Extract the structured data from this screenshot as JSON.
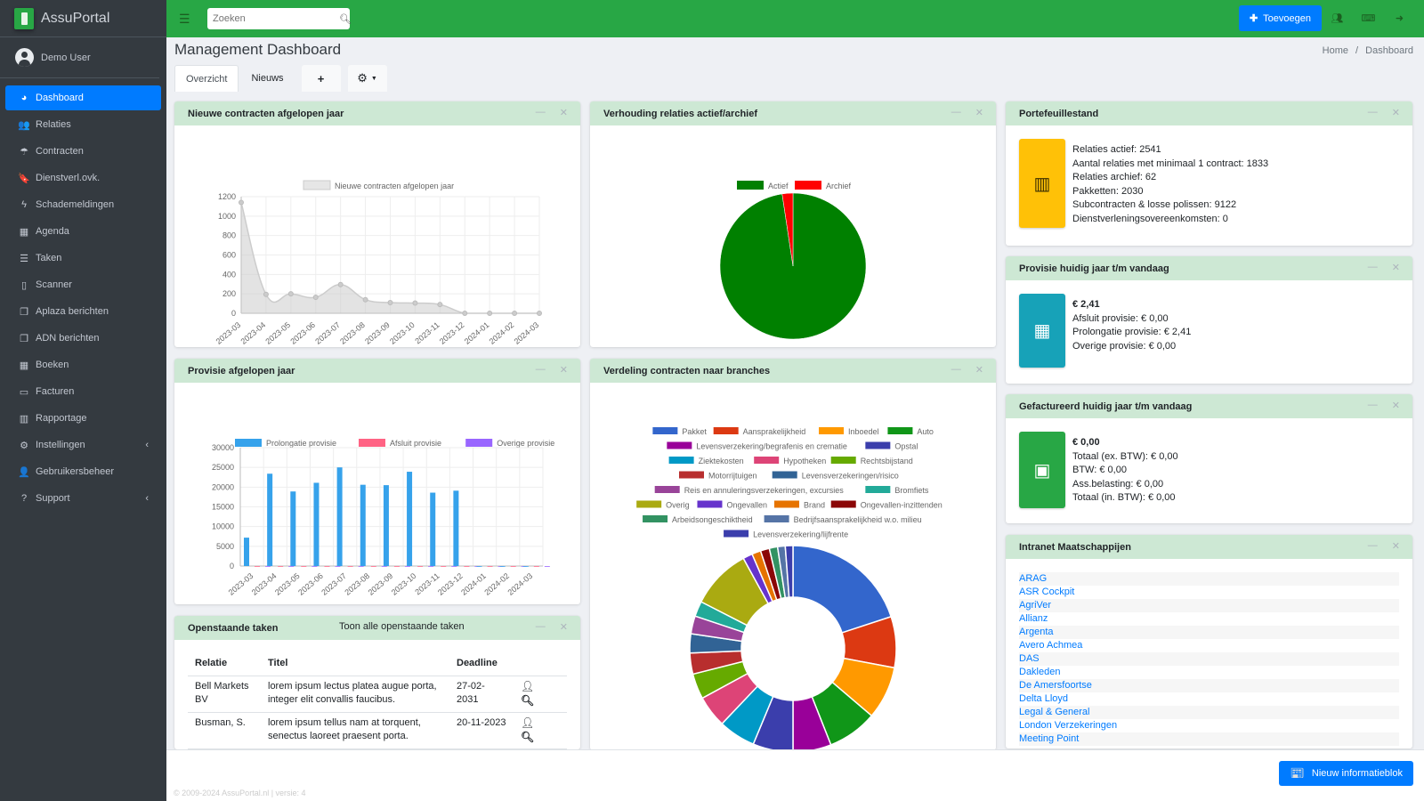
{
  "app": {
    "name": "AssuPortal",
    "user": "Demo User"
  },
  "sidebar": {
    "items": [
      {
        "label": "Dashboard",
        "icon": "dashboard-icon",
        "glyph": "◕",
        "active": true
      },
      {
        "label": "Relaties",
        "icon": "users-icon",
        "glyph": "👥"
      },
      {
        "label": "Contracten",
        "icon": "umbrella-icon",
        "glyph": "☂"
      },
      {
        "label": "Dienstverl.ovk.",
        "icon": "bookmark-icon",
        "glyph": "🔖"
      },
      {
        "label": "Schademeldingen",
        "icon": "bolt-icon",
        "glyph": "ϟ"
      },
      {
        "label": "Agenda",
        "icon": "calendar-icon",
        "glyph": "▦"
      },
      {
        "label": "Taken",
        "icon": "tasks-icon",
        "glyph": "☰"
      },
      {
        "label": "Scanner",
        "icon": "file-pdf-icon",
        "glyph": "▯"
      },
      {
        "label": "Aplaza berichten",
        "icon": "copy-icon",
        "glyph": "❐"
      },
      {
        "label": "ADN berichten",
        "icon": "copy-icon",
        "glyph": "❐"
      },
      {
        "label": "Boeken",
        "icon": "calculator-icon",
        "glyph": "▦"
      },
      {
        "label": "Facturen",
        "icon": "money-icon",
        "glyph": "▭"
      },
      {
        "label": "Rapportage",
        "icon": "chart-bar-icon",
        "glyph": "▥"
      },
      {
        "label": "Instellingen",
        "icon": "cog-icon",
        "glyph": "⚙",
        "submenu": true
      },
      {
        "label": "Gebruikersbeheer",
        "icon": "user-icon",
        "glyph": "👤"
      },
      {
        "label": "Support",
        "icon": "question-icon",
        "glyph": "?",
        "submenu": true
      }
    ]
  },
  "topbar": {
    "search_placeholder": "Zoeken",
    "add_label": "Toevoegen"
  },
  "header": {
    "title": "Management Dashboard",
    "breadcrumb": [
      "Home",
      "Dashboard"
    ]
  },
  "tabs": [
    {
      "label": "Overzicht",
      "active": true
    },
    {
      "label": "Nieuws"
    }
  ],
  "cards": {
    "new_contracts": {
      "title": "Nieuwe contracten afgelopen jaar"
    },
    "relations_ratio": {
      "title": "Verhouding relaties actief/archief"
    },
    "portfolio": {
      "title": "Portefeuillestand",
      "lines": [
        "Relaties actief: 2541",
        "Aantal relaties met minimaal 1 contract: 1833",
        "Relaties archief: 62",
        "Pakketten: 2030",
        "Subcontracten & losse polissen: 9122",
        "Dienstverleningsovereenkomsten: 0"
      ],
      "color": "#ffc107"
    },
    "commission_current": {
      "title": "Provisie huidig jaar t/m vandaag",
      "total": "€ 2,41",
      "lines": [
        "Afsluit provisie: € 0,00",
        "Prolongatie provisie: € 2,41",
        "Overige provisie: € 0,00"
      ],
      "color": "#17a2b8"
    },
    "invoiced": {
      "title": "Gefactureerd huidig jaar t/m vandaag",
      "total": "€ 0,00",
      "lines": [
        "Totaal (ex. BTW): € 0,00",
        "BTW: € 0,00",
        "Ass.belasting: € 0,00",
        "Totaal (in. BTW): € 0,00"
      ],
      "color": "#28a745"
    },
    "commission_year": {
      "title": "Provisie afgelopen jaar"
    },
    "branches": {
      "title": "Verdeling contracten naar branches"
    },
    "tasks": {
      "title": "Openstaande taken",
      "show_all": "Toon alle openstaande taken",
      "columns": [
        "Relatie",
        "Titel",
        "Deadline"
      ],
      "rows": [
        {
          "relatie": "Bell Markets BV",
          "titel": "lorem ipsum lectus platea augue porta, integer elit convallis faucibus.",
          "deadline": "27-02-2031"
        },
        {
          "relatie": "Busman, S.",
          "titel": "lorem ipsum tellus nam at torquent, senectus laoreet praesent porta.",
          "deadline": "20-11-2023"
        }
      ]
    },
    "intranet": {
      "title": "Intranet Maatschappijen",
      "links": [
        "ARAG",
        "ASR Cockpit",
        "AgriVer",
        "Allianz",
        "Argenta",
        "Avero Achmea",
        "DAS",
        "Dakleden",
        "De Amersfoortse",
        "Delta Lloyd",
        "Legal & General",
        "London Verzekeringen",
        "Meeting Point"
      ]
    }
  },
  "footer": {
    "text": "© 2009-2024 AssuPortal.nl | versie: 4",
    "new_block_label": "Nieuw informatieblok"
  },
  "chart_data": [
    {
      "type": "area",
      "title": "Nieuwe contracten afgelopen jaar",
      "legend": [
        "Nieuwe contracten afgelopen jaar"
      ],
      "categories": [
        "2023-03",
        "2023-04",
        "2023-05",
        "2023-06",
        "2023-07",
        "2023-08",
        "2023-09",
        "2023-10",
        "2023-11",
        "2023-12",
        "2024-01",
        "2024-02",
        "2024-03"
      ],
      "values": [
        1140,
        195,
        200,
        165,
        295,
        140,
        110,
        105,
        90,
        0,
        0,
        0,
        0
      ],
      "ylim": [
        0,
        1200
      ],
      "yticks": [
        0,
        200,
        400,
        600,
        800,
        1000,
        1200
      ],
      "grid": true,
      "color": "#cccccc"
    },
    {
      "type": "pie",
      "title": "Verhouding relaties actief/archief",
      "labels": [
        "Actief",
        "Archief"
      ],
      "values": [
        2541,
        62
      ],
      "colors": [
        "#008000",
        "#ff0000"
      ],
      "legend": "top"
    },
    {
      "type": "bar",
      "title": "Provisie afgelopen jaar",
      "categories": [
        "2023-03",
        "2023-04",
        "2023-05",
        "2023-06",
        "2023-07",
        "2023-08",
        "2023-09",
        "2023-10",
        "2023-11",
        "2023-12",
        "2024-01",
        "2024-02",
        "2024-03"
      ],
      "series": [
        {
          "name": "Prolongatie provisie",
          "color": "#36a2eb",
          "values": [
            7200,
            23400,
            18900,
            21100,
            25000,
            20600,
            20500,
            23900,
            18600,
            19100,
            0,
            0,
            0
          ]
        },
        {
          "name": "Afsluit provisie",
          "color": "#ff6384",
          "values": [
            0,
            0,
            0,
            0,
            0,
            0,
            0,
            0,
            0,
            0,
            0,
            0,
            0
          ]
        },
        {
          "name": "Overige provisie",
          "color": "#9966ff",
          "values": [
            0,
            0,
            0,
            0,
            0,
            0,
            0,
            0,
            0,
            0,
            0,
            0,
            0
          ]
        }
      ],
      "ylim": [
        0,
        30000
      ],
      "yticks": [
        0,
        5000,
        10000,
        15000,
        20000,
        25000,
        30000
      ],
      "grid": true,
      "legend": "top"
    },
    {
      "type": "pie",
      "variant": "doughnut",
      "title": "Verdeling contracten naar branches",
      "legend": "top",
      "slices": [
        {
          "label": "Pakket",
          "color": "#3366cc",
          "value": 20
        },
        {
          "label": "Aansprakelijkheid",
          "color": "#dc3912",
          "value": 8
        },
        {
          "label": "Inboedel",
          "color": "#ff9900",
          "value": 8.3
        },
        {
          "label": "Auto",
          "color": "#109618",
          "value": 7.8
        },
        {
          "label": "Levensverzekering/begrafenis en crematie",
          "color": "#990099",
          "value": 6
        },
        {
          "label": "Opstal",
          "color": "#3b3eac",
          "value": 6.3
        },
        {
          "label": "Ziektekosten",
          "color": "#0099c6",
          "value": 5.8
        },
        {
          "label": "Hypotheken",
          "color": "#dd4477",
          "value": 5
        },
        {
          "label": "Rechtsbijstand",
          "color": "#66aa00",
          "value": 4
        },
        {
          "label": "Motorrijtuigen",
          "color": "#b82e2e",
          "value": 3.3
        },
        {
          "label": "Levensverzekeringen/risico",
          "color": "#316395",
          "value": 3
        },
        {
          "label": "Reis en annuleringsverzekeringen, excursies",
          "color": "#994499",
          "value": 2.8
        },
        {
          "label": "Bromfiets",
          "color": "#22aa99",
          "value": 2.4
        },
        {
          "label": "Overig",
          "color": "#aaaa11",
          "value": 9.5
        },
        {
          "label": "Ongevallen",
          "color": "#6633cc",
          "value": 1.5
        },
        {
          "label": "Brand",
          "color": "#e67300",
          "value": 1.4
        },
        {
          "label": "Ongevallen-inzittenden",
          "color": "#8b0707",
          "value": 1.4
        },
        {
          "label": "Arbeidsongeschiktheid",
          "color": "#329262",
          "value": 1.3
        },
        {
          "label": "Bedrijfsaansprakelijkheid w.o. milieu",
          "color": "#5574a6",
          "value": 1.2
        },
        {
          "label": "Levensverzekering/lijfrente",
          "color": "#3b3eac",
          "value": 1.2
        }
      ]
    }
  ]
}
